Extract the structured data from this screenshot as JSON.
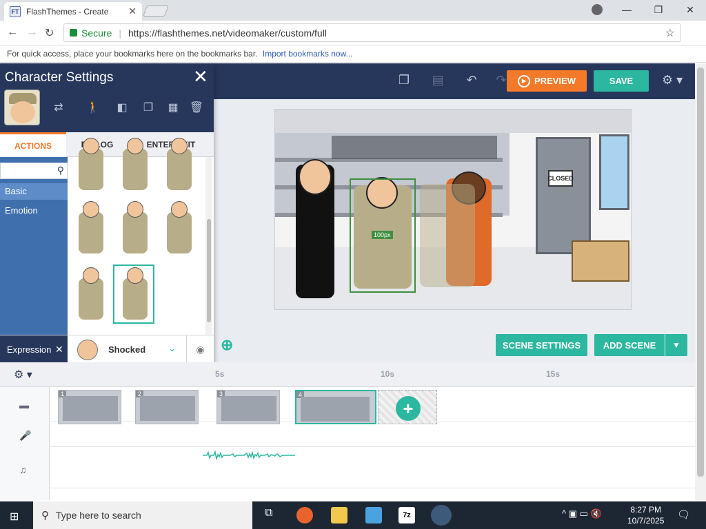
{
  "browser": {
    "tab_title": "FlashThemes - Create",
    "favicon_text": "FT",
    "secure_label": "Secure",
    "url": "https://flashthemes.net/videomaker/custom/full",
    "bookmarks_text": "For quick access, place your bookmarks here on the bookmarks bar.",
    "bookmarks_link": "Import bookmarks now..."
  },
  "topbar": {
    "preview_label": "PREVIEW",
    "save_label": "SAVE"
  },
  "panel": {
    "title": "Character Settings",
    "tabs": [
      {
        "label": "ACTIONS",
        "active": true
      },
      {
        "label": "DIALOG",
        "active": false
      },
      {
        "label": "ENTER/EXIT",
        "active": false
      }
    ],
    "categories": [
      {
        "label": "Basic",
        "active": true
      },
      {
        "label": "Emotion",
        "active": false
      }
    ],
    "expression_label": "Expression",
    "expression_value": "Shocked"
  },
  "stage": {
    "sign_text": "CLOSED",
    "size_label": "100px"
  },
  "scene_buttons": {
    "scene_settings": "SCENE SETTINGS",
    "add_scene": "ADD SCENE"
  },
  "timeline": {
    "ticks": [
      "5s",
      "10s",
      "15s"
    ],
    "scenes": [
      "1",
      "2",
      "3",
      "4"
    ]
  },
  "taskbar": {
    "search_placeholder": "Type here to search",
    "time": "8:27 PM",
    "date": "10/7/2025"
  },
  "colors": {
    "accent_teal": "#2bb7a0",
    "accent_orange": "#f47a2a",
    "navy": "#27375c"
  }
}
